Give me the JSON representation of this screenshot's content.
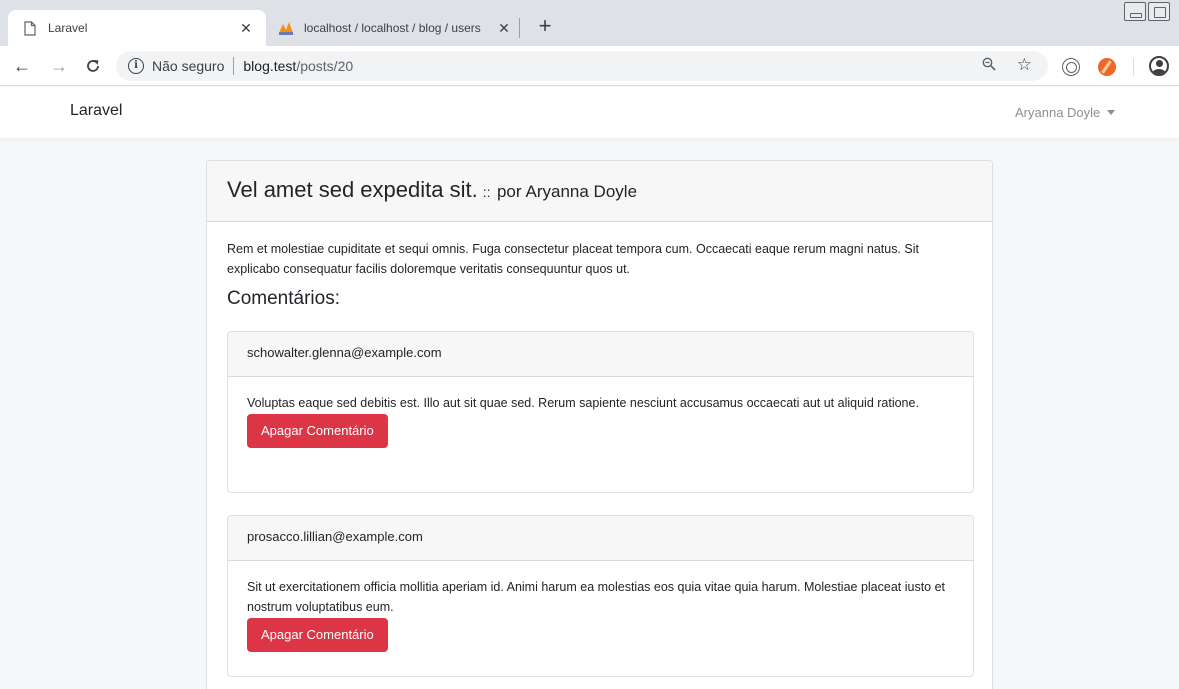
{
  "browser": {
    "tabs": [
      {
        "title": "Laravel",
        "active": true
      },
      {
        "title": "localhost / localhost / blog / users",
        "active": false
      }
    ],
    "address": {
      "security_label": "Não seguro",
      "host": "blog.test",
      "path": "/posts/20"
    }
  },
  "app": {
    "brand": "Laravel",
    "user_name": "Aryanna Doyle"
  },
  "post": {
    "title": "Vel amet sed expedita sit.",
    "separator": "::",
    "author_prefix": "por",
    "author": "Aryanna Doyle",
    "body": "Rem et molestiae cupiditate et sequi omnis. Fuga consectetur placeat tempora cum. Occaecati eaque rerum magni natus. Sit explicabo consequatur facilis doloremque veritatis consequuntur quos ut.",
    "comments_heading": "Comentários:",
    "comments": [
      {
        "email": "schowalter.glenna@example.com",
        "text": "Voluptas eaque sed debitis est. Illo aut sit quae sed. Rerum sapiente nesciunt accusamus occaecati aut ut aliquid ratione.",
        "delete_label": "Apagar Comentário"
      },
      {
        "email": "prosacco.lillian@example.com",
        "text": "Sit ut exercitationem officia mollitia aperiam id. Animi harum ea molestias eos quia vitae quia harum. Molestiae placeat iusto et nostrum voluptatibus eum.",
        "delete_label": "Apagar Comentário"
      }
    ]
  },
  "colors": {
    "danger": "#dc3545",
    "page_bg": "#f5f8fa",
    "card_header_bg": "#f7f7f7"
  }
}
